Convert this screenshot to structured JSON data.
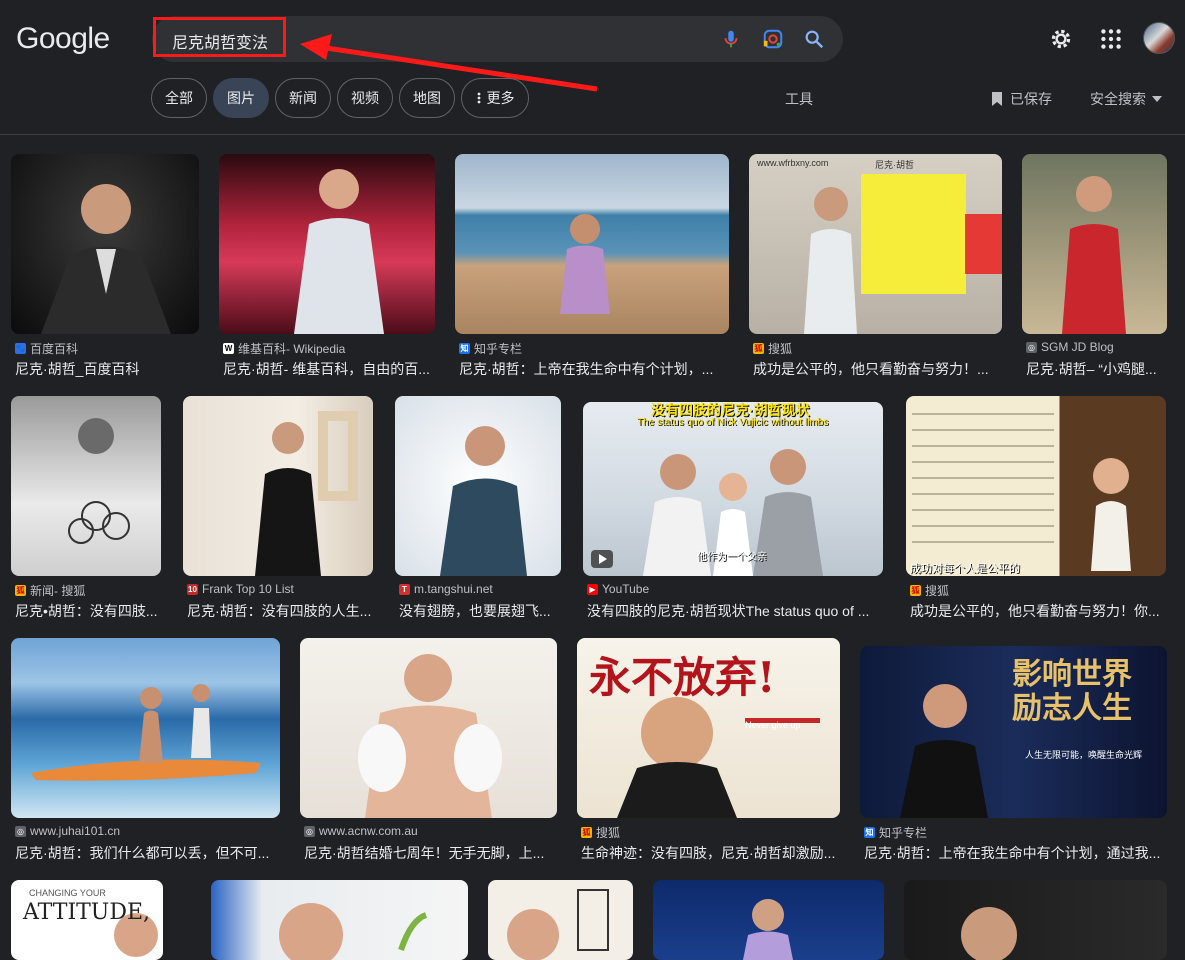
{
  "logo": "Google",
  "search": {
    "query": "尼克胡哲变法"
  },
  "tabs": [
    {
      "label": "全部"
    },
    {
      "label": "图片"
    },
    {
      "label": "新闻"
    },
    {
      "label": "视频"
    },
    {
      "label": "地图"
    },
    {
      "label": "更多"
    }
  ],
  "tools_label": "工具",
  "saved_label": "已保存",
  "safesearch_label": "安全搜索",
  "colors": {
    "accent_chip": "#394457",
    "background": "#202124",
    "annotation": "#ff1a1a"
  },
  "results": [
    {
      "source": "百度百科",
      "title": "尼克·胡哲_百度百科"
    },
    {
      "source": "维基百科- Wikipedia",
      "title": "尼克·胡哲- 维基百科，自由的百..."
    },
    {
      "source": "知乎专栏",
      "title": "尼克·胡哲：上帝在我生命中有个计划，..."
    },
    {
      "source": "搜狐",
      "title": "成功是公平的，他只看勤奋与努力！..."
    },
    {
      "source": "SGM JD Blog",
      "title": "尼克·胡哲– “小鸡腿..."
    },
    {
      "source": "新闻- 搜狐",
      "title": "尼克•胡哲：没有四肢..."
    },
    {
      "source": "Frank Top 10 List",
      "title": "尼克·胡哲：没有四肢的人生..."
    },
    {
      "source": "m.tangshui.net",
      "title": "没有翅膀，也要展翅飞..."
    },
    {
      "source": "YouTube",
      "title": "没有四肢的尼克·胡哲现状The status quo of ..."
    },
    {
      "source": "搜狐",
      "title": "成功是公平的，他只看勤奋与努力！你..."
    },
    {
      "source": "www.juhai101.cn",
      "title": "尼克·胡哲：我们什么都可以丢，但不可..."
    },
    {
      "source": "www.acnw.com.au",
      "title": "尼克·胡哲结婚七周年！无手无脚，上..."
    },
    {
      "source": "搜狐",
      "title": "生命神迹：没有四肢，尼克·胡哲却激励..."
    },
    {
      "source": "知乎专栏",
      "title": "尼克·胡哲：上帝在我生命中有个计划，通过我..."
    }
  ],
  "thumb_text": {
    "t3_url": "www.wfrbxny.com",
    "t3_name": "尼克·胡哲",
    "t8_title": "没有四肢的尼克·胡哲现状",
    "t8_sub": "The status quo of Nick Vujicic without limbs",
    "t8_cap": "他作为一个父亲",
    "t9_cap": "成功对每个人是公平的",
    "t12_big": "永不放弃!",
    "t12_sub": "Never give up",
    "t13_big": "影响世界 励志人生",
    "t13_sub": "人生无限可能，唤醒生命光辉",
    "t14_a": "CHANGING YOUR",
    "t14_b": "ATTITUDE,"
  }
}
